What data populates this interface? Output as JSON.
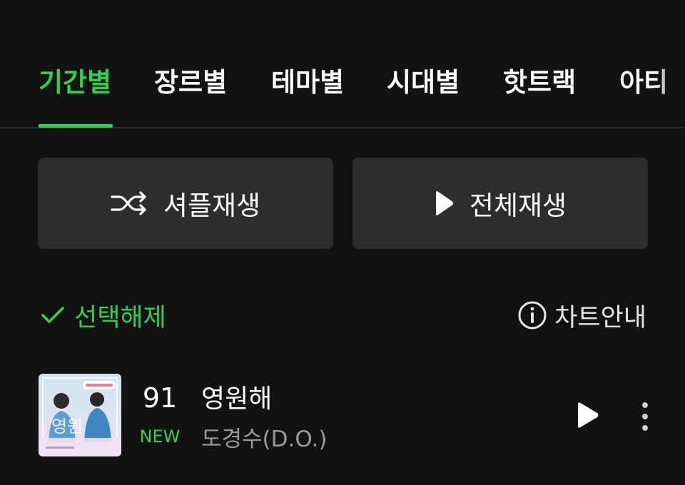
{
  "tabs": [
    {
      "label": "기간별",
      "active": true
    },
    {
      "label": "장르별",
      "active": false
    },
    {
      "label": "테마별",
      "active": false
    },
    {
      "label": "시대별",
      "active": false
    },
    {
      "label": "핫트랙",
      "active": false
    },
    {
      "label": "아티",
      "active": false
    }
  ],
  "actions": {
    "shuffle_label": "셔플재생",
    "play_all_label": "전체재생"
  },
  "selection": {
    "deselect_label": "선택해제",
    "chart_info_label": "차트안내"
  },
  "songs": [
    {
      "rank": "91",
      "badge": "NEW",
      "title": "영원해",
      "artist": "도경수(D.O.)",
      "album_art_text": "영원"
    }
  ],
  "colors": {
    "background": "#121212",
    "accent": "#2fd155",
    "button_bg": "#2d2d2d",
    "secondary_text": "#9a9a9a"
  },
  "icons": {
    "shuffle": "shuffle-icon",
    "play": "play-icon",
    "check": "check-icon",
    "info": "info-icon",
    "more": "more-vertical-icon"
  }
}
